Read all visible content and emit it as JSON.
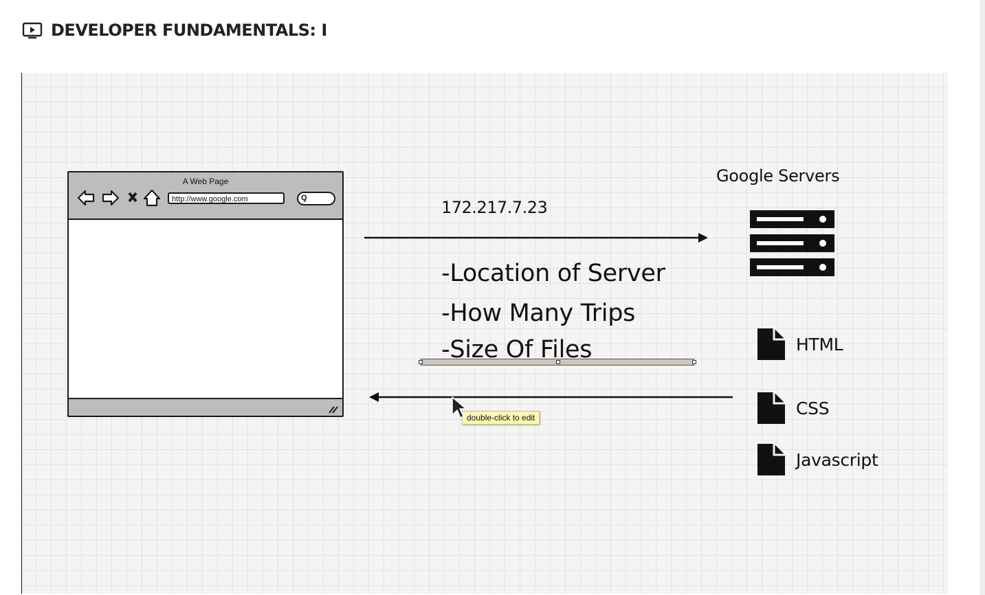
{
  "header": {
    "title": "DEVELOPER FUNDAMENTALS: I",
    "icon": "video-play-icon"
  },
  "video": {
    "browser": {
      "title": "A Web Page",
      "url": "http://www.google.com",
      "search_glyph": "Q"
    },
    "ip_address": "172.217.7.23",
    "servers_label": "Google Servers",
    "bullets": [
      "-Location of Server",
      "-How Many Trips",
      "-Size Of Files"
    ],
    "files": [
      "HTML",
      "CSS",
      "Javascript"
    ],
    "tooltip": "double-click to edit"
  },
  "colors": {
    "grid_bg": "#f4f4f4",
    "grid_line": "#e3e3e3",
    "ink": "#111111",
    "chrome_gray": "#bdbdbd",
    "tooltip_bg": "#fbf8b2"
  }
}
